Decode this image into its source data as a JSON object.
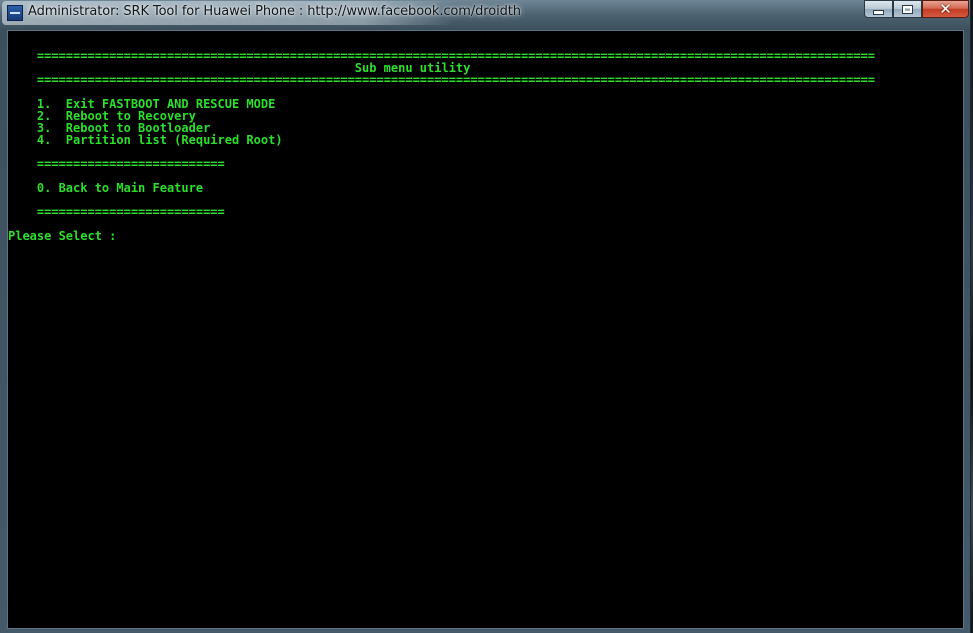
{
  "window": {
    "title": "Administrator:  SRK Tool for Huawei Phone : http://www.facebook.com/droidth",
    "icon": "cmd-app-icon",
    "controls": {
      "minimize": "minimize-icon",
      "maximize": "maximize-icon",
      "close": "close-icon"
    }
  },
  "console": {
    "text_color": "#2bdf2b",
    "background": "#000000",
    "separator_long": "====================================================================================================================",
    "separator_short": "==========================",
    "header": "Sub menu utility",
    "menu": [
      "1.  Exit FASTBOOT AND RESCUE MODE",
      "2.  Reboot to Recovery",
      "3.  Reboot to Bootloader",
      "4.  Partition list (Required Root)"
    ],
    "back_option": "0. Back to Main Feature",
    "prompt": "Please Select :"
  }
}
